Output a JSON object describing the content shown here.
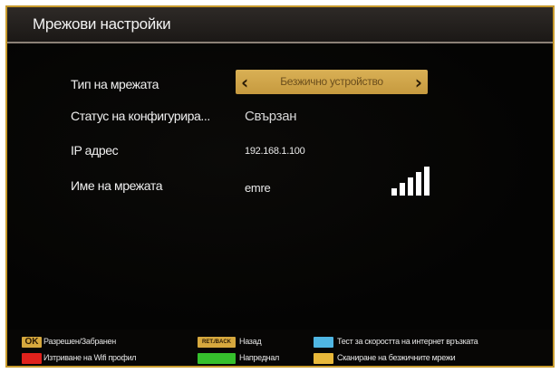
{
  "window": {
    "title": "Мрежови настройки"
  },
  "settings": [
    {
      "label": "Тип на мрежата",
      "value": "Безжично устройство"
    },
    {
      "label": "Статус на конфигурира...",
      "value": "Свързан"
    },
    {
      "label": "IP адрес",
      "value": "192.168.1.100"
    },
    {
      "label": "Име на мрежата",
      "value": "emre"
    }
  ],
  "selector": {
    "left_arrow": "‹",
    "right_arrow": "›"
  },
  "signal": {
    "level": 5,
    "max": 5
  },
  "footer": {
    "ok_key": "OK",
    "ok_label": "Разрешен/Забранен",
    "ret_key": "RET./BACK",
    "ret_label": "Назад",
    "blue_label": "Тест за скоростта на интернет връзката",
    "red_label": "Изтриване на Wifi профил",
    "green_label": "Напреднал",
    "yellow_label": "Сканиране на безжичните мрежи"
  },
  "colors": {
    "accent": "#d6a83e",
    "red": "#e0221c",
    "green": "#35c02c",
    "blue": "#4fb6e3",
    "yellow": "#e8b83a"
  }
}
